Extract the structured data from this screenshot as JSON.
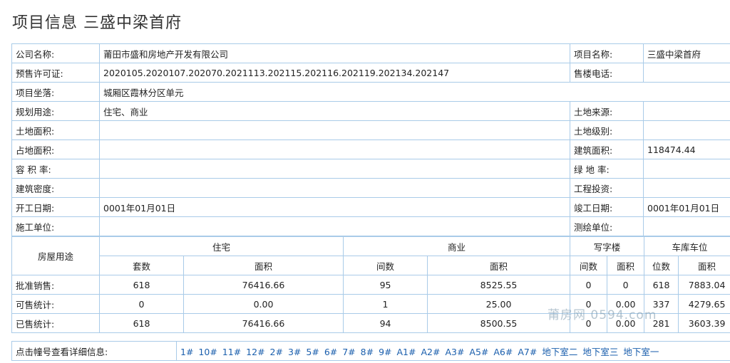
{
  "page_title": "项目信息 三盛中梁首府",
  "info": {
    "company_label": "公司名称:",
    "company": "莆田市盛和房地产开发有限公司",
    "project_label": "项目名称:",
    "project": "三盛中梁首府",
    "permit_label": "预售许可证:",
    "permit": "2020105.2020107.202070.2021113.202115.202116.202119.202134.202147",
    "phone_label": "售楼电话:",
    "phone": "",
    "location_label": "项目坐落:",
    "location": "城厢区霞林分区单元",
    "usage_label": "规划用途:",
    "usage": "住宅、商业",
    "land_source_label": "土地来源:",
    "land_source": "",
    "land_area_label": "土地面积:",
    "land_area": "",
    "land_level_label": "土地级别:",
    "land_level": "",
    "occupied_area_label": "占地面积:",
    "occupied_area": "",
    "build_area_label": "建筑面积:",
    "build_area": "118474.44",
    "far_label": "容 积 率:",
    "far": "",
    "green_label": "绿 地 率:",
    "green": "",
    "density_label": "建筑密度:",
    "density": "",
    "investment_label": "工程投资:",
    "investment": "",
    "start_label": "开工日期:",
    "start": "0001年01月01日",
    "finish_label": "竣工日期:",
    "finish": "0001年01月01日",
    "construction_label": "施工单位:",
    "construction": "",
    "survey_label": "测绘单位:",
    "survey": ""
  },
  "stats": {
    "usage_header": "房屋用途",
    "groups": [
      "住宅",
      "商业",
      "写字楼",
      "车库车位"
    ],
    "subheaders": [
      "套数",
      "面积",
      "间数",
      "面积",
      "间数",
      "面积",
      "位数",
      "面积"
    ],
    "rows": [
      {
        "label": "批准销售:",
        "values": [
          "618",
          "76416.66",
          "95",
          "8525.55",
          "0",
          "0",
          "618",
          "7883.04"
        ]
      },
      {
        "label": "可售统计:",
        "values": [
          "0",
          "0.00",
          "1",
          "25.00",
          "0",
          "0.00",
          "337",
          "4279.65"
        ]
      },
      {
        "label": "已售统计:",
        "values": [
          "618",
          "76416.66",
          "94",
          "8500.55",
          "0",
          "0.00",
          "281",
          "3603.39"
        ]
      }
    ]
  },
  "links": {
    "label": "点击幢号查看详细信息:",
    "buildings": [
      "1#",
      "10#",
      "11#",
      "12#",
      "2#",
      "3#",
      "5#",
      "6#",
      "7#",
      "8#",
      "9#",
      "A1#",
      "A2#",
      "A3#",
      "A5#",
      "A6#",
      "A7#",
      "地下室二",
      "地下室三",
      "地下室一"
    ]
  },
  "watermark": "莆房网 0594.com"
}
